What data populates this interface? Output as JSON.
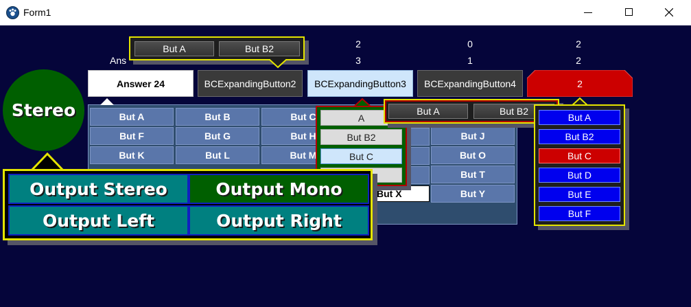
{
  "window": {
    "title": "Form1"
  },
  "labels_row1": [
    "2",
    "0",
    "2"
  ],
  "labels_row2": [
    "Ans",
    "3",
    "1",
    "2"
  ],
  "expanding_buttons": [
    "Answer 24",
    "BCExpandingButton2",
    "BCExpandingButton3",
    "BCExpandingButton4",
    "2"
  ],
  "top_popup": {
    "buttons": [
      "But A",
      "But B2"
    ]
  },
  "middle_popup": {
    "buttons": [
      "But A",
      "But B2"
    ]
  },
  "stereo": {
    "label": "Stereo"
  },
  "grid": {
    "rows": [
      [
        "But A",
        "But B",
        "But C",
        "",
        "But J"
      ],
      [
        "But F",
        "But G",
        "But H",
        "",
        "But O"
      ],
      [
        "But K",
        "But L",
        "But M",
        "",
        "But T"
      ],
      [
        "",
        "",
        "",
        "But X",
        "But Y"
      ]
    ]
  },
  "list_popup": {
    "items": [
      "A",
      "But B2",
      "But C"
    ]
  },
  "right_popup": {
    "items": [
      "But A",
      "But B2",
      "But C",
      "But D",
      "But E",
      "But F"
    ]
  },
  "output_popup": {
    "buttons": [
      "Output Stereo",
      "Output Mono",
      "Output Left",
      "Output Right"
    ]
  },
  "colors": {
    "client_bg": "#05053a",
    "popup_border": "#e4e400",
    "stereo_green": "#005f00",
    "teal": "#008080",
    "selected_red": "#cc0000",
    "grid_blue": "#5a76aa"
  },
  "icons": [
    "app-icon",
    "minimize-icon",
    "maximize-icon",
    "close-icon"
  ]
}
